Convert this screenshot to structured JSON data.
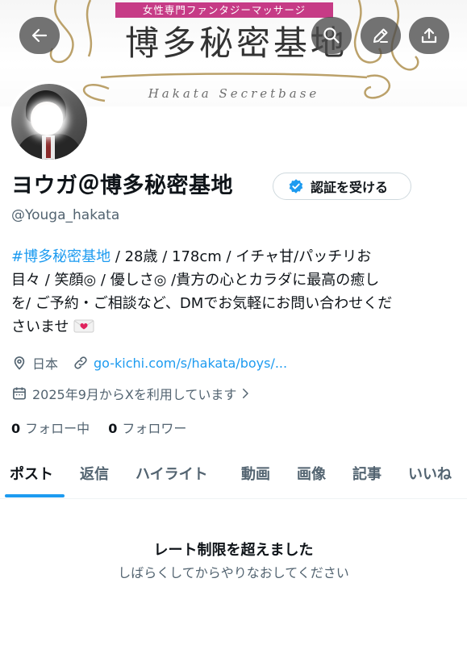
{
  "banner": {
    "tagline": "女性専門ファンタジーマッサージ",
    "title": "博多秘密基地",
    "subtitle": "Hakata Secretbase"
  },
  "profile": {
    "display_name": "ヨウガ＠博多秘密基地",
    "handle": "@Youga_hakata",
    "verify_label": "認証を受ける",
    "bio_hashtag": "#博多秘密基地",
    "bio_line1": " / 28歳 / 178cm / イチャ甘/パッチリお",
    "bio_line2": "目々 / 笑顔◎ / 優しさ◎ /貴方の心とカラダに最高の癒し",
    "bio_line3": "を/ ご予約・ご相談など、DMでお気軽にお問い合わせくだ",
    "bio_line4": "さいませ",
    "location": "日本",
    "website": "go-kichi.com/s/hakata/boys/...",
    "joined": "2025年9月からXを利用しています",
    "following_count": "0",
    "following_label": "フォロー中",
    "followers_count": "0",
    "followers_label": "フォロワー"
  },
  "tabs": [
    "ポスト",
    "返信",
    "ハイライト",
    "動画",
    "画像",
    "記事",
    "いいね"
  ],
  "empty_state": {
    "title": "レート制限を超えました",
    "subtitle": "しばらくしてからやりなおしてください"
  },
  "icons": {
    "back": "arrow-left-icon",
    "search": "search-icon",
    "edit": "pencil-icon",
    "share": "share-icon",
    "verified": "verified-badge-icon",
    "location": "location-pin-icon",
    "link": "link-icon",
    "calendar": "calendar-icon",
    "heart_letter": "love-letter-icon"
  },
  "colors": {
    "accent": "#1d9bf0",
    "text": "#0f1419",
    "secondary": "#536471",
    "banner_tag": "#c63b86"
  }
}
